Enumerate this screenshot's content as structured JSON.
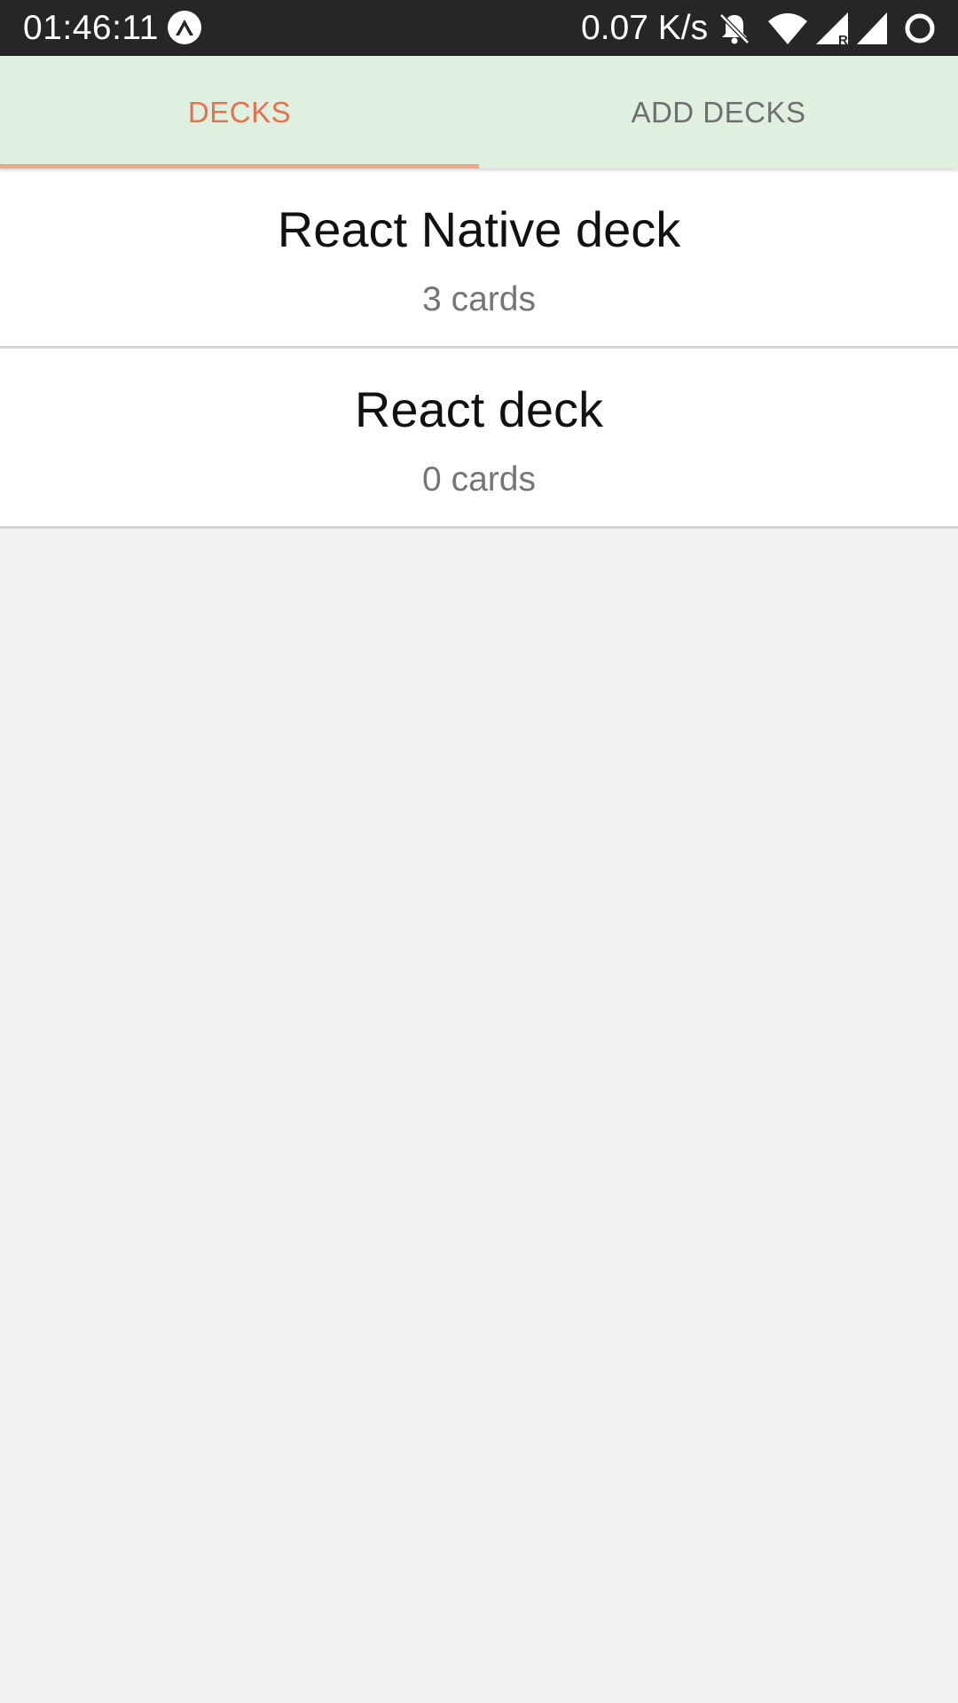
{
  "status_bar": {
    "time": "01:46:11",
    "network_speed": "0.07 K/s",
    "icons": [
      "expo-icon",
      "notifications-off-icon",
      "wifi-icon",
      "signal-roaming-icon",
      "signal-icon",
      "battery-ring-icon"
    ]
  },
  "tabs": [
    {
      "label": "DECKS",
      "active": true
    },
    {
      "label": "ADD DECKS",
      "active": false
    }
  ],
  "colors": {
    "tab_bar_background": "#dff0e0",
    "active_tab": "#e8704e",
    "inactive_tab": "#6f6f6f",
    "indicator": "#eba98d",
    "screen_background": "#f1f1f1"
  },
  "decks": [
    {
      "title": "React Native deck",
      "count": "3 cards"
    },
    {
      "title": "React deck",
      "count": "0 cards"
    }
  ]
}
